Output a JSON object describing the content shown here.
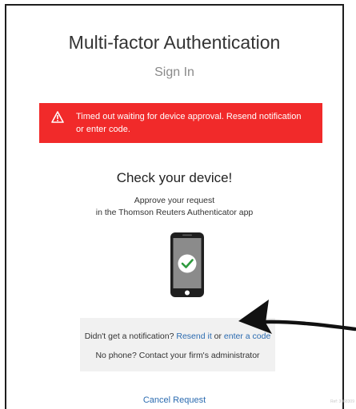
{
  "header": {
    "title": "Multi-factor Authentication",
    "subtitle": "Sign In"
  },
  "alert": {
    "icon": "warning-icon",
    "line1": "Timed out waiting for device approval. Resend notification",
    "line2": "or enter code.",
    "background_color": "#f12a2a"
  },
  "main": {
    "heading": "Check your device!",
    "instruction_line1": "Approve your request",
    "instruction_line2": "in the Thomson Reuters Authenticator app",
    "phone_icon": "phone-checkmark-icon"
  },
  "help": {
    "notification_prefix": "Didn't get a notification? ",
    "resend_link": "Resend it",
    "or_text": " or ",
    "enter_code_link": "enter a code",
    "no_phone_text": "No phone? Contact your firm's administrator"
  },
  "footer": {
    "cancel_link": "Cancel Request"
  },
  "annotation": {
    "arrow_icon": "pointer-arrow-icon"
  },
  "watermark": {
    "text": "Ref: 3068309"
  },
  "colors": {
    "link": "#2b6bb0",
    "alert": "#f12a2a",
    "help_box": "#f1f1f1"
  }
}
